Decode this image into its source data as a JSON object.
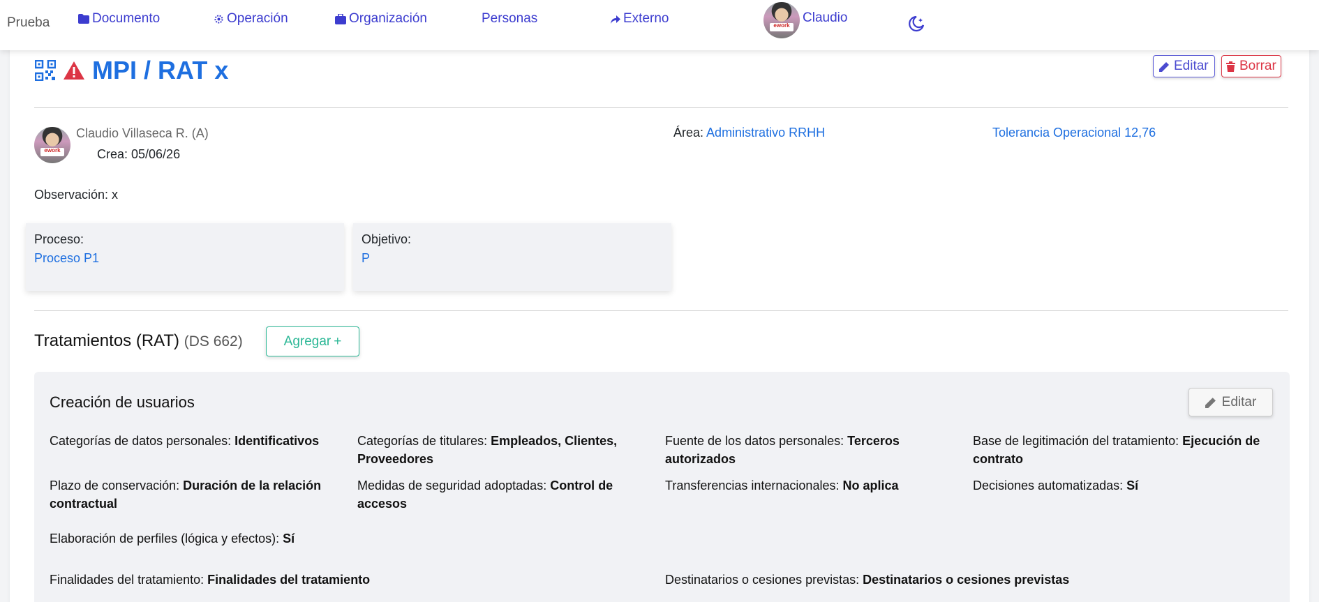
{
  "nav": {
    "brand": "Prueba",
    "items": [
      {
        "label": "Documento",
        "icon": "folder-icon"
      },
      {
        "label": "Operación",
        "icon": "gears-icon"
      },
      {
        "label": "Organización",
        "icon": "briefcase-icon"
      },
      {
        "label": "Personas",
        "icon": ""
      },
      {
        "label": "Externo",
        "icon": "share-arrow-icon"
      }
    ],
    "user": "Claudio",
    "theme_icon": "moon-star-icon"
  },
  "header": {
    "title": "MPI / RAT x",
    "edit_label": "Editar",
    "delete_label": "Borrar"
  },
  "meta": {
    "author": "Claudio Villaseca R. (A)",
    "created": "Crea: 05/06/26",
    "area_label": "Área:",
    "area_value": "Administrativo RRHH",
    "tolerance": "Tolerancia Operacional 12,76",
    "observation": "Observación: x"
  },
  "boxes": {
    "process_label": "Proceso:",
    "process_value": "Proceso P1",
    "objective_label": "Objetivo:",
    "objective_value": "P"
  },
  "rat": {
    "title": "Tratamientos (RAT)",
    "subtitle": "(DS 662)",
    "add_label": "Agregar",
    "add_icon": "+"
  },
  "treatment": {
    "name": "Creación de usuarios",
    "edit_label": "Editar",
    "fields": [
      {
        "label": "Categorías de datos personales: ",
        "value": "Identificativos"
      },
      {
        "label": "Categorías de titulares: ",
        "value": "Empleados, Clientes, Proveedores"
      },
      {
        "label": "Fuente de los datos personales: ",
        "value": "Terceros autorizados"
      },
      {
        "label": "Base de legitimación del tratamiento: ",
        "value": "Ejecución de contrato"
      },
      {
        "label": "Plazo de conservación: ",
        "value": "Duración de la relación contractual"
      },
      {
        "label": "Medidas de seguridad adoptadas: ",
        "value": "Control de accesos"
      },
      {
        "label": "Transferencias internacionales: ",
        "value": "No aplica"
      },
      {
        "label": "Decisiones automatizadas: ",
        "value": "Sí"
      },
      {
        "label": "Elaboración de perfiles (lógica y efectos): ",
        "value": "Sí"
      },
      {
        "label": "Finalidades del tratamiento: ",
        "value": "Finalidades del tratamiento"
      },
      {
        "label": "Destinatarios o cesiones previstas: ",
        "value": "Destinatarios o cesiones previstas"
      }
    ]
  }
}
